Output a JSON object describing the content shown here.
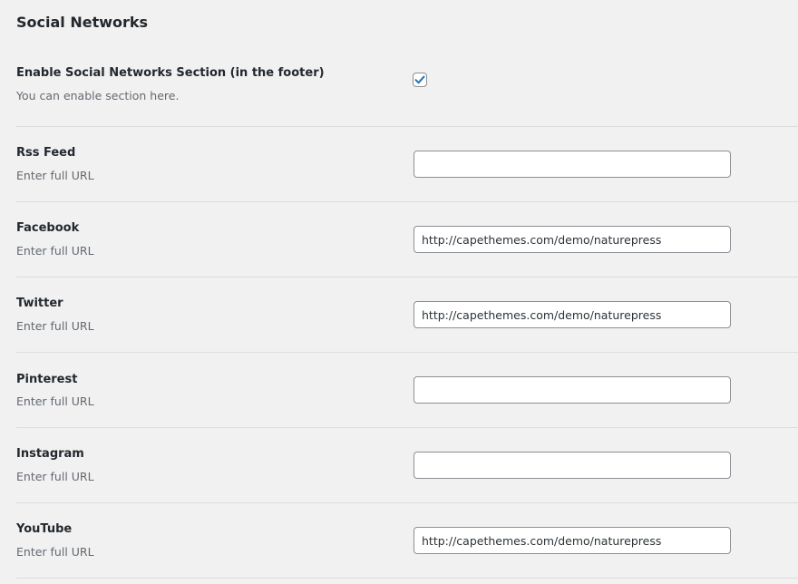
{
  "section_title": "Social Networks",
  "accent_color": "#2271b1",
  "enable": {
    "label": "Enable Social Networks Section (in the footer)",
    "description": "You can enable section here.",
    "checked": true
  },
  "fields": [
    {
      "label": "Rss Feed",
      "description": "Enter full URL",
      "value": ""
    },
    {
      "label": "Facebook",
      "description": "Enter full URL",
      "value": "http://capethemes.com/demo/naturepress"
    },
    {
      "label": "Twitter",
      "description": "Enter full URL",
      "value": "http://capethemes.com/demo/naturepress"
    },
    {
      "label": "Pinterest",
      "description": "Enter full URL",
      "value": ""
    },
    {
      "label": "Instagram",
      "description": "Enter full URL",
      "value": ""
    },
    {
      "label": "YouTube",
      "description": "Enter full URL",
      "value": "http://capethemes.com/demo/naturepress"
    }
  ]
}
